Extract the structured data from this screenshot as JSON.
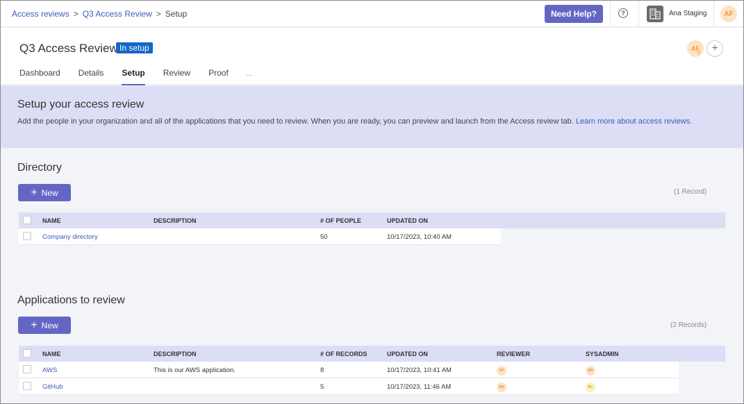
{
  "breadcrumb": {
    "items": [
      "Access reviews",
      "Q3 Access Review",
      "Setup"
    ],
    "separator": ">"
  },
  "topbar": {
    "help_label": "Need Help?",
    "help_icon": "?",
    "org_name": "Ana Staging",
    "user_initials": "AF"
  },
  "header": {
    "title": "Q3 Access Review",
    "status": "In setup",
    "owner_initials": "AF",
    "add_label": "+",
    "tabs": [
      "Dashboard",
      "Details",
      "Setup",
      "Review",
      "Proof"
    ],
    "more_label": "...",
    "active_tab": "Setup"
  },
  "banner": {
    "title": "Setup your access review",
    "text": "Add the people in your organization and all of the applications that you need to review. When you are ready, you can preview and launch from the Access review tab.",
    "link": "Learn more about access reviews."
  },
  "directory": {
    "title": "Directory",
    "new_label": "New",
    "count": "(1 Record)",
    "columns": [
      "NAME",
      "DESCRIPTION",
      "# OF PEOPLE",
      "UPDATED ON"
    ],
    "rows": [
      {
        "name": "Company directory",
        "description": "",
        "people": "50",
        "updated": "10/17/2023, 10:40 AM"
      }
    ]
  },
  "applications": {
    "title": "Applications to review",
    "new_label": "New",
    "count": "(2 Records)",
    "columns": [
      "NAME",
      "DESCRIPTION",
      "# OF RECORDS",
      "UPDATED ON",
      "REVIEWER",
      "SYSADMIN"
    ],
    "rows": [
      {
        "name": "AWS",
        "description": "This is our AWS application.",
        "records": "8",
        "updated": "10/17/2023, 10:41 AM",
        "reviewer": "AF",
        "sysadmin": "RH"
      },
      {
        "name": "GitHub",
        "description": "",
        "records": "5",
        "updated": "10/17/2023, 11:46 AM",
        "reviewer": "RH",
        "sysadmin": "PL"
      }
    ]
  },
  "colors": {
    "primary": "#6466c4",
    "badge": "#1466c8",
    "banner_bg": "#dcdef5",
    "link": "#3d5bb8"
  }
}
